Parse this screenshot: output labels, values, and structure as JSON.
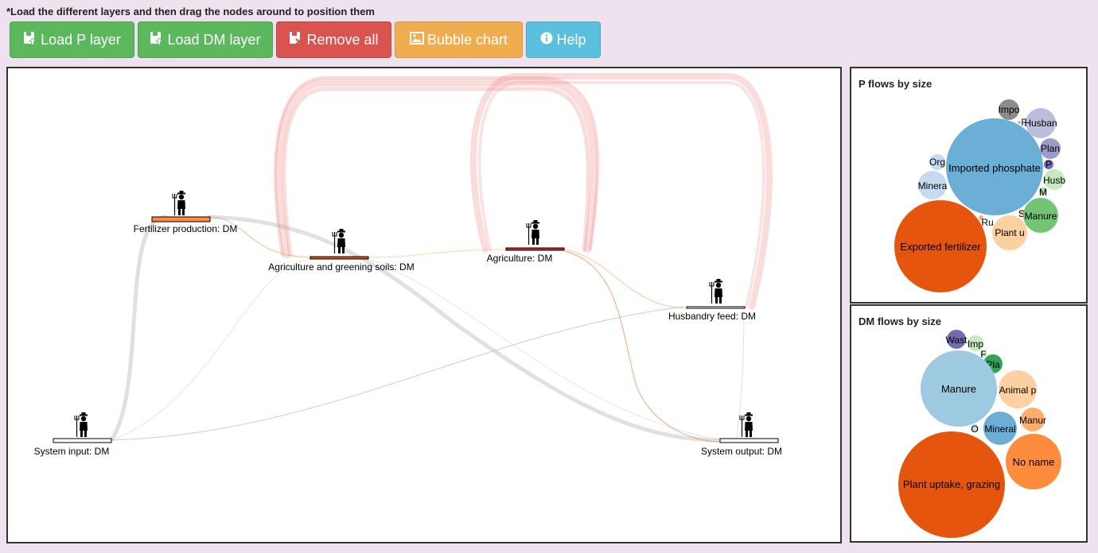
{
  "instruction": "*Load the different layers and then drag the nodes around to position them",
  "toolbar": {
    "load_p": "Load P layer",
    "load_dm": "Load DM layer",
    "remove_all": "Remove all",
    "bubble_chart": "Bubble chart",
    "help": "Help"
  },
  "colors": {
    "green": "#5cb85c",
    "red": "#d9534f",
    "orange": "#f0ad4e",
    "cyan": "#5bc0de",
    "page_bg": "#eee2ef"
  },
  "sankey": {
    "nodes": {
      "fertilizer": "Fertilizer production: DM",
      "agri_greening": "Agriculture and greening soils: DM",
      "agriculture": "Agriculture: DM",
      "husbandry": "Husbandry feed: DM",
      "system_input": "System input: DM",
      "system_output": "System output: DM"
    },
    "node_icon": "farmer-icon"
  },
  "p_flows": {
    "title": "P flows by size",
    "bubbles": [
      {
        "label": "Impo",
        "color": "#8c8c8c"
      },
      {
        "label": "F",
        "color": "#bdbdbd"
      },
      {
        "label": "Husban",
        "color": "#bcbddc"
      },
      {
        "label": "Plan",
        "color": "#9e9ac8"
      },
      {
        "label": "P",
        "color": "#756bb1"
      },
      {
        "label": "Org",
        "color": "#c6dbef"
      },
      {
        "label": "Imported phosphate",
        "color": "#6baed6"
      },
      {
        "label": "Husb",
        "color": "#c7e9c0"
      },
      {
        "label": "Minera",
        "color": "#c6dbef"
      },
      {
        "label": "M",
        "color": "#a1d99b"
      },
      {
        "label": "S",
        "color": "#fdd0a2"
      },
      {
        "label": "Manure",
        "color": "#74c476"
      },
      {
        "label": "Ru",
        "color": "#fdae6b"
      },
      {
        "label": "Plant u",
        "color": "#fdd0a2"
      },
      {
        "label": "Exported fertilizer",
        "color": "#e6550d"
      }
    ]
  },
  "dm_flows": {
    "title": "DM flows by size",
    "bubbles": [
      {
        "label": "Wast",
        "color": "#756bb1"
      },
      {
        "label": "Imp",
        "color": "#c7e9c0"
      },
      {
        "label": "F",
        "color": "#c7e9c0"
      },
      {
        "label": "Pla",
        "color": "#31a354"
      },
      {
        "label": "Manure",
        "color": "#9ecae1"
      },
      {
        "label": "Animal p",
        "color": "#fdd0a2"
      },
      {
        "label": "O",
        "color": "#c6dbef"
      },
      {
        "label": "Mineral",
        "color": "#6baed6"
      },
      {
        "label": "Manur",
        "color": "#fdae6b"
      },
      {
        "label": "No name",
        "color": "#fd8d3c"
      },
      {
        "label": "Plant uptake, grazing",
        "color": "#e6550d"
      }
    ]
  }
}
